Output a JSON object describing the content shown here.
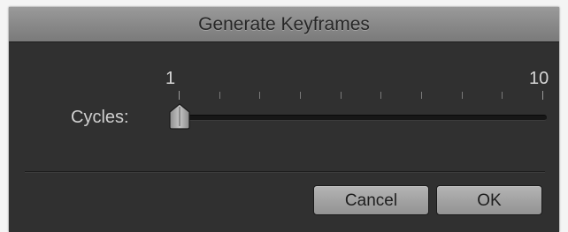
{
  "dialog": {
    "title": "Generate Keyframes"
  },
  "slider": {
    "label": "Cycles:",
    "min_label": "1",
    "max_label": "10",
    "min": 1,
    "max": 10,
    "value": 1
  },
  "buttons": {
    "cancel_label": "Cancel",
    "ok_label": "OK"
  },
  "colors": {
    "dialog_bg": "#303030",
    "titlebar": "#8b8b8b",
    "button": "#a3a3a3"
  }
}
